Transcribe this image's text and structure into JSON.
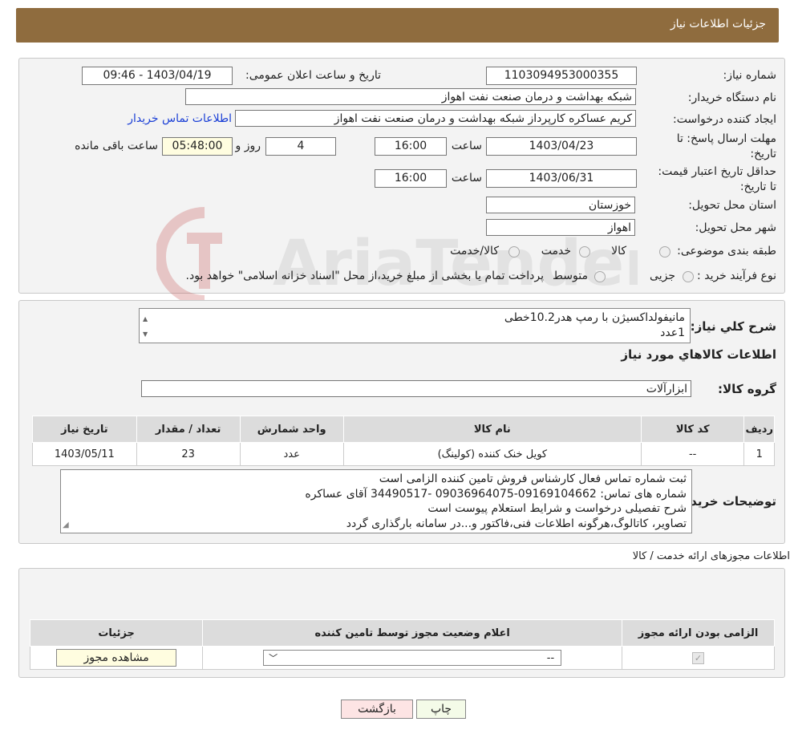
{
  "header": {
    "title": "جزئیات اطلاعات نیاز"
  },
  "form": {
    "need_number_label": "شماره نیاز:",
    "need_number": "1103094953000355",
    "announce_label": "تاریخ و ساعت اعلان عمومی:",
    "announce_value": "1403/04/19 - 09:46",
    "buyer_org_label": "نام دستگاه خریدار:",
    "buyer_org": "شبکه بهداشت و درمان صنعت نفت اهواز",
    "creator_label": "ایجاد کننده درخواست:",
    "creator": "کریم عساکره کارپرداز شبکه بهداشت و درمان صنعت نفت اهواز",
    "buyer_contact_link": "اطلاعات تماس خریدار",
    "deadline_label": "مهلت ارسال پاسخ: تا تاریخ:",
    "deadline_date": "1403/04/23",
    "time_label": "ساعت",
    "deadline_time": "16:00",
    "days_value": "4",
    "days_label": "روز و",
    "remaining_time": "05:48:00",
    "remaining_label": "ساعت باقی مانده",
    "validity_label": "حداقل تاریخ اعتبار قیمت: تا تاریخ:",
    "validity_date": "1403/06/31",
    "validity_time": "16:00",
    "province_label": "استان محل تحویل:",
    "province": "خوزستان",
    "city_label": "شهر محل تحویل:",
    "city": "اهواز",
    "category_label": "طبقه بندی موضوعی:",
    "category_options": [
      "کالا",
      "خدمت",
      "کالا/خدمت"
    ],
    "process_label": "نوع فرآیند خرید :",
    "process_options": [
      "جزیی",
      "متوسط"
    ],
    "process_note": "پرداخت تمام یا بخشی از مبلغ خرید،از محل \"اسناد خزانه اسلامی\" خواهد بود."
  },
  "summary": {
    "label": "شرح کلي نياز:",
    "lines": [
      "مانیفولداکسیژن با رمپ هدر10.2خطی",
      "1عدد"
    ],
    "items_title": "اطلاعات کالاهاي مورد نياز",
    "group_label": "گروه کالا:",
    "group_value": "ابزارآلات"
  },
  "items_table": {
    "headers": [
      "رديف",
      "کد کالا",
      "نام کالا",
      "واحد شمارش",
      "تعداد / مقدار",
      "تاریخ نیاز"
    ],
    "rows": [
      [
        "1",
        "--",
        "کویل خنک کننده (کولینگ)",
        "عدد",
        "23",
        "1403/05/11"
      ]
    ]
  },
  "buyer_notes": {
    "label": "توضیحات خریدار:",
    "lines": [
      "ثبت شماره تماس فعال کارشناس فروش تامین کننده الزامی است",
      "شماره های تماس: 09169104662-09036964075 -34490517 آقای عساکره",
      "شرح تفصیلی درخواست و شرایط استعلام پیوست است",
      "تصاویر، کاتالوگ،هرگونه اطلاعات فنی،فاکتور و...در سامانه بارگذاری گردد"
    ]
  },
  "permits": {
    "title": "اطلاعات مجوزهای ارائه خدمت / کالا",
    "headers": [
      "الزامی بودن ارائه مجوز",
      "اعلام وضعیت مجوز توسط تامین کننده",
      "جزئیات"
    ],
    "select_value": "--",
    "view_button": "مشاهده مجوز"
  },
  "watermark": {
    "text": "AriaTender.neT"
  },
  "buttons": {
    "print": "چاپ",
    "back": "بازگشت"
  }
}
